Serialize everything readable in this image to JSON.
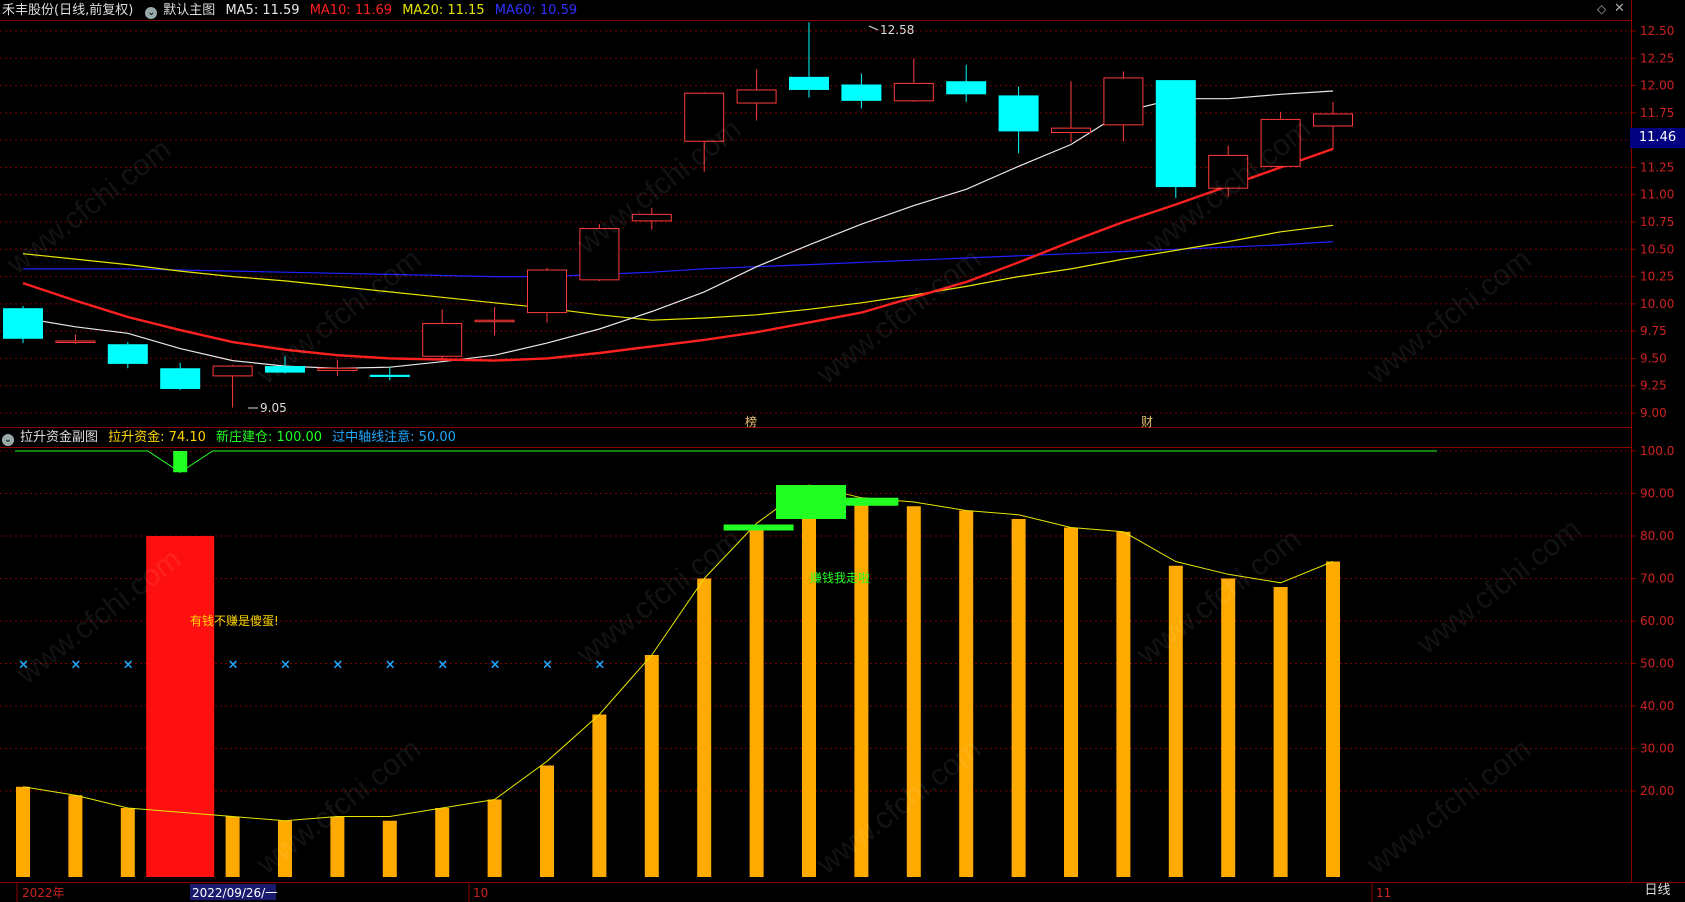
{
  "main_legend": {
    "title": "禾丰股份(日线,前复权)",
    "chart_name": "默认主图",
    "ma5": "MA5: 11.59",
    "ma10": "MA10: 11.69",
    "ma20": "MA20: 11.15",
    "ma60": "MA60: 10.59"
  },
  "sub_legend": {
    "title": "拉升资金副图",
    "v1": "拉升资金: 74.10",
    "v2": "新庄建仓: 100.00",
    "v3": "过中轴线注意: 50.00"
  },
  "price_tag": "11.46",
  "period_tab": "日线",
  "date_labels": [
    "2022年",
    "2022/09/26/一",
    "10",
    "11"
  ],
  "event_markers": [
    "榜",
    "财"
  ],
  "annotations": {
    "high": "12.58",
    "low": "9.05",
    "sub_text_1": "有钱不赚是傻蛋!",
    "sub_text_2": "赚钱我走啦"
  },
  "watermark": "www.cfchi.com",
  "colors": {
    "up": "#ff3b3b",
    "down": "#00ffff",
    "ma5": "#e8e8e8",
    "ma10": "#ff2020",
    "ma20": "#e6e600",
    "ma60": "#2020ff",
    "bar": "#ffaa00",
    "alert_bar": "#ff1010",
    "green": "#22ff22",
    "grid": "#7a0000"
  },
  "chart_data": [
    {
      "type": "candlestick",
      "title": "禾丰股份(日线,前复权)",
      "y_ticks": [
        "12.50",
        "12.25",
        "12.00",
        "11.75",
        "11.50",
        "11.25",
        "11.00",
        "10.75",
        "10.50",
        "10.25",
        "10.00",
        "9.75",
        "9.50",
        "9.25",
        "9.00"
      ],
      "ylim": [
        8.98,
        12.62
      ],
      "candles": [
        {
          "o": 9.96,
          "h": 9.98,
          "l": 9.64,
          "c": 9.68
        },
        {
          "o": 9.65,
          "h": 9.72,
          "l": 9.63,
          "c": 9.66
        },
        {
          "o": 9.63,
          "h": 9.65,
          "l": 9.41,
          "c": 9.45
        },
        {
          "o": 9.41,
          "h": 9.46,
          "l": 9.21,
          "c": 9.22
        },
        {
          "o": 9.34,
          "h": 9.44,
          "l": 9.05,
          "c": 9.43
        },
        {
          "o": 9.43,
          "h": 9.52,
          "l": 9.36,
          "c": 9.37
        },
        {
          "o": 9.39,
          "h": 9.49,
          "l": 9.34,
          "c": 9.41
        },
        {
          "o": 9.35,
          "h": 9.42,
          "l": 9.3,
          "c": 9.33
        },
        {
          "o": 9.52,
          "h": 9.95,
          "l": 9.5,
          "c": 9.82
        },
        {
          "o": 9.85,
          "h": 9.97,
          "l": 9.71,
          "c": 9.85
        },
        {
          "o": 9.92,
          "h": 10.33,
          "l": 9.83,
          "c": 10.31
        },
        {
          "o": 10.22,
          "h": 10.73,
          "l": 10.21,
          "c": 10.69
        },
        {
          "o": 10.76,
          "h": 10.88,
          "l": 10.68,
          "c": 10.82
        },
        {
          "o": 11.49,
          "h": 11.94,
          "l": 11.21,
          "c": 11.93
        },
        {
          "o": 11.84,
          "h": 12.15,
          "l": 11.68,
          "c": 11.96
        },
        {
          "o": 12.08,
          "h": 12.58,
          "l": 11.89,
          "c": 11.96
        },
        {
          "o": 12.01,
          "h": 12.11,
          "l": 11.79,
          "c": 11.86
        },
        {
          "o": 11.86,
          "h": 12.25,
          "l": 11.85,
          "c": 12.02
        },
        {
          "o": 12.04,
          "h": 12.19,
          "l": 11.85,
          "c": 11.92
        },
        {
          "o": 11.91,
          "h": 11.99,
          "l": 11.38,
          "c": 11.58
        },
        {
          "o": 11.57,
          "h": 12.04,
          "l": 11.48,
          "c": 11.61
        },
        {
          "o": 11.64,
          "h": 12.13,
          "l": 11.49,
          "c": 12.07
        },
        {
          "o": 12.05,
          "h": 12.05,
          "l": 10.97,
          "c": 11.07
        },
        {
          "o": 11.06,
          "h": 11.45,
          "l": 10.98,
          "c": 11.36
        },
        {
          "o": 11.26,
          "h": 11.76,
          "l": 11.26,
          "c": 11.69
        },
        {
          "o": 11.63,
          "h": 11.85,
          "l": 11.42,
          "c": 11.74
        }
      ],
      "ma5": [
        9.87,
        9.79,
        9.73,
        9.59,
        9.48,
        9.43,
        9.41,
        9.42,
        9.47,
        9.53,
        9.64,
        9.77,
        9.93,
        10.11,
        10.34,
        10.54,
        10.73,
        10.9,
        11.05,
        11.26,
        11.46,
        11.76,
        11.88,
        11.88,
        11.92,
        11.95
      ],
      "ma10": [
        10.19,
        10.03,
        9.88,
        9.76,
        9.65,
        9.58,
        9.53,
        9.5,
        9.49,
        9.48,
        9.5,
        9.55,
        9.61,
        9.67,
        9.74,
        9.83,
        9.92,
        10.06,
        10.2,
        10.38,
        10.57,
        10.75,
        10.91,
        11.08,
        11.25,
        11.42
      ],
      "ma20": [
        10.46,
        10.41,
        10.36,
        10.3,
        10.25,
        10.21,
        10.16,
        10.11,
        10.06,
        10.01,
        9.96,
        9.9,
        9.85,
        9.87,
        9.9,
        9.95,
        10.01,
        10.08,
        10.16,
        10.25,
        10.32,
        10.41,
        10.49,
        10.57,
        10.66,
        10.72
      ],
      "ma60": [
        10.32,
        10.32,
        10.32,
        10.31,
        10.3,
        10.29,
        10.28,
        10.27,
        10.26,
        10.25,
        10.25,
        10.27,
        10.29,
        10.32,
        10.34,
        10.36,
        10.38,
        10.4,
        10.42,
        10.44,
        10.46,
        10.48,
        10.5,
        10.52,
        10.54,
        10.57
      ],
      "ma_visible_from": {
        "ma5": 0,
        "ma10": 0,
        "ma20": 0,
        "ma60": 0
      }
    },
    {
      "type": "bar",
      "title": "拉升资金副图",
      "y_ticks": [
        "100.0",
        "90.00",
        "80.00",
        "70.00",
        "60.00",
        "50.00",
        "40.00",
        "30.00",
        "20.00"
      ],
      "ylim": [
        0,
        103
      ],
      "values": [
        21,
        19,
        16,
        16,
        14,
        13,
        14,
        13,
        16,
        18,
        26,
        38,
        52,
        70,
        82,
        92,
        89,
        87,
        86,
        84,
        82,
        81,
        73,
        70,
        68,
        74
      ],
      "line": [
        21,
        19,
        16,
        15,
        14,
        13,
        14,
        14,
        16,
        18,
        27,
        38,
        52,
        70,
        83,
        92,
        89,
        88,
        86,
        85,
        82,
        81,
        74,
        71,
        69,
        74
      ],
      "alert_bar": {
        "index": 3,
        "value": 80
      },
      "x_markers": [
        0,
        1,
        2,
        4,
        5,
        6,
        7,
        8,
        9,
        10,
        11
      ],
      "x_marker_value": 50,
      "top_line": 100,
      "top_dip": {
        "index": 3,
        "low": 95,
        "bar_top": 100
      },
      "green_blocks": [
        {
          "index": 14,
          "value": 82
        },
        {
          "index": 15,
          "value": 88
        },
        {
          "index": 16,
          "value": 89
        }
      ]
    }
  ]
}
